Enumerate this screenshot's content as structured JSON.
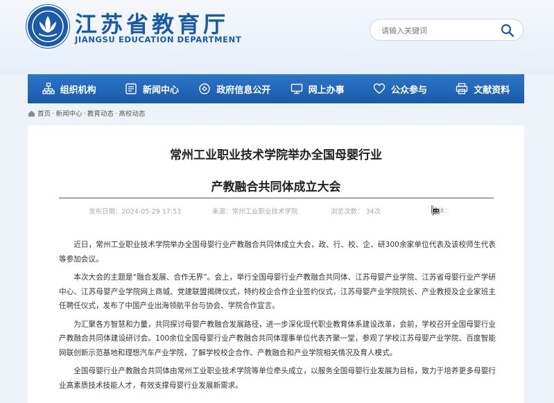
{
  "header": {
    "title": "江苏省教育厅",
    "subtitle": "JIANGSU EDUCATION DEPARTMENT",
    "logo_icon": "lotus-emblem-icon",
    "brand_color": "#1a5aa8"
  },
  "search": {
    "placeholder": "请输入关键词",
    "icon": "search-icon"
  },
  "nav": {
    "items": [
      {
        "label": "组织机构",
        "icon": "org-chart-icon"
      },
      {
        "label": "新闻中心",
        "icon": "news-icon"
      },
      {
        "label": "政府信息公开",
        "icon": "open-info-icon"
      },
      {
        "label": "网上办事",
        "icon": "monitor-icon"
      },
      {
        "label": "公众参与",
        "icon": "heart-icon"
      },
      {
        "label": "文献资料",
        "icon": "printer-icon"
      }
    ]
  },
  "breadcrumb": {
    "items": [
      "首页",
      "新闻中心",
      "教育动态",
      "高校动态"
    ],
    "separator": "-",
    "icon": "home-icon"
  },
  "article": {
    "title_line1": "常州工业职业技术学院举办全国母婴行业",
    "title_line2": "产教融合共同体成立大会",
    "publish_time": "发布日期：2024-05-29 17:53",
    "source": "来源：常州工业职业技术学院",
    "views": "浏览次数： 34次",
    "font_size_label": "字体：",
    "font_size_options": [
      "大",
      "中",
      "小"
    ],
    "paragraphs": [
      "近日，常州工业职业技术学院举办全国母婴行业产教融合共同体成立大会，政、行、校、企、研300余家单位代表及该校师生代表等参加会议。",
      "本次大会的主题是“融合发展、合作无界”。会上，举行全国母婴行业产教融合共同体、江苏母婴产业学院、江苏省母婴行业产学研中心、江苏母婴产业学院网上商城、党建联盟揭牌仪式，特约校企合作企业签约仪式，江苏母婴产业学院院长、产业教授及企业家班主任聘任仪式，发布了中国产业出海领航平台与协会、学院合作宣言。",
      "为汇聚各方智慧和力量，共同探讨母婴产教融合发展路径，进一步深化现代职业教育体系建设改革，会前，学校召开全国母婴行业产教融合共同体建设研讨会。100余位全国母婴行业产教融合共同体理事单位代表齐聚一堂，参观了学校江苏母婴产业学院、百度智能网联创新示范基地和理想汽车产业学院，了解学校校企合作、产教融合和产业学院相关情况及育人模式。",
      "全国母婴行业产教融合共同体由常州工业职业技术学院等单位牵头成立，以服务全国母婴行业发展为目标，致力于培养更多母婴行业高素质技术技能人才，有效支撑母婴行业发展新需求。"
    ]
  }
}
